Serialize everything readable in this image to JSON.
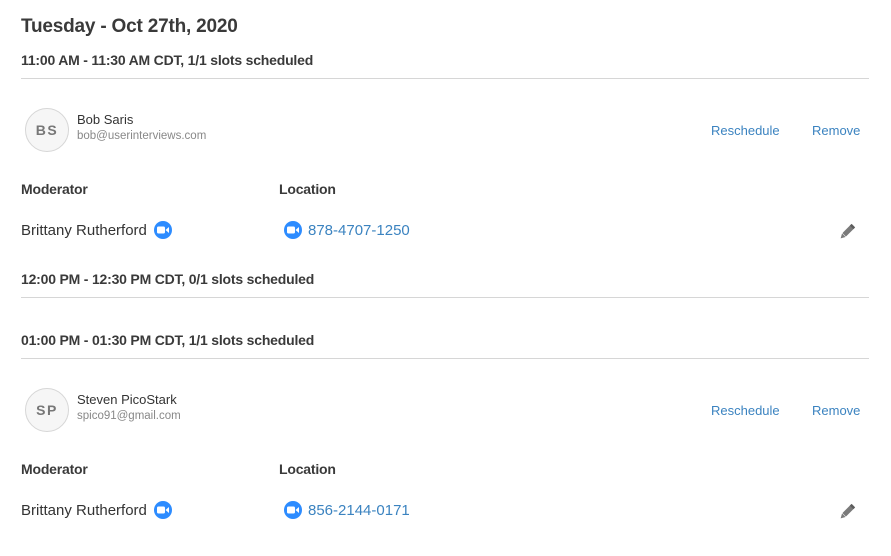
{
  "day_title": "Tuesday - Oct 27th, 2020",
  "labels": {
    "moderator": "Moderator",
    "location": "Location",
    "reschedule": "Reschedule",
    "remove": "Remove"
  },
  "slots": [
    {
      "header": "11:00 AM - 11:30 AM CDT, 1/1 slots scheduled",
      "participant": {
        "initials": "BS",
        "name": "Bob Saris",
        "email": "bob@userinterviews.com"
      },
      "moderator": "Brittany Rutherford",
      "location_phone": "878-4707-1250"
    },
    {
      "header": "12:00 PM - 12:30 PM CDT, 0/1 slots scheduled"
    },
    {
      "header": "01:00 PM - 01:30 PM CDT, 1/1 slots scheduled",
      "participant": {
        "initials": "SP",
        "name": "Steven PicoStark",
        "email": "spico91@gmail.com"
      },
      "moderator": "Brittany Rutherford",
      "location_phone": "856-2144-0171"
    }
  ],
  "icons": {
    "video": "zoom-video-icon",
    "edit": "pencil-icon"
  },
  "colors": {
    "link": "#3b83c0",
    "zoom": "#2d8cff",
    "divider": "#d6d6d6",
    "heading": "#3a3a3a"
  }
}
